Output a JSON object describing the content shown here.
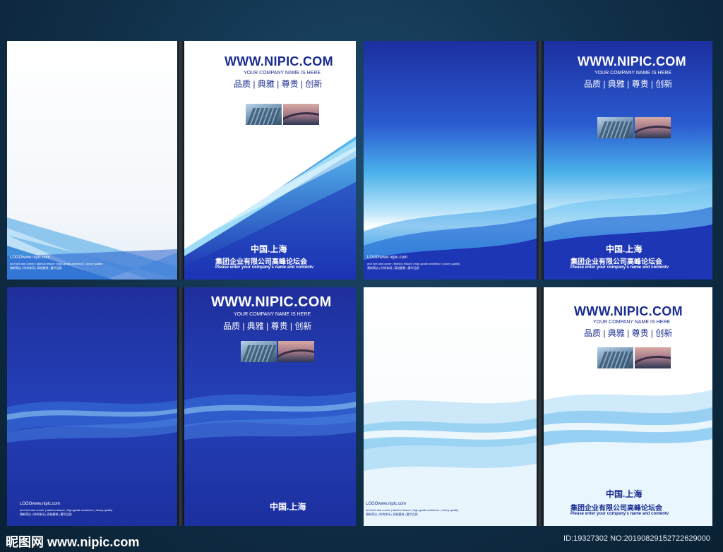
{
  "brochure": {
    "url": "WWW.NIPIC.COM",
    "company_en": "YOUR COMPANY NAME IS HERE",
    "motto": "品质 | 典雅 | 尊贵 | 创新",
    "city": "中国.上海",
    "company_cn": "集团企业有限公司高峰论坛会",
    "tagline": "Please enter your company's name and contentv",
    "logo": "LOGOwww.nipic.com",
    "micro1": "and font and corner | fashion leisure | high-grade ambience | luxury quality",
    "micro2": "潮新简洁 | 时尚休闲 | 高档雅致 | 奢华品质"
  },
  "watermark": {
    "brand": "昵图网 www.nipic.com",
    "id": "ID:19327302 NO:20190829152722629000"
  },
  "colors": {
    "navy_text": "#1a2c8f",
    "deep_blue": "#1b2f9e",
    "royal_blue": "#1e3bb8",
    "sky_blue": "#3ea8e6"
  }
}
